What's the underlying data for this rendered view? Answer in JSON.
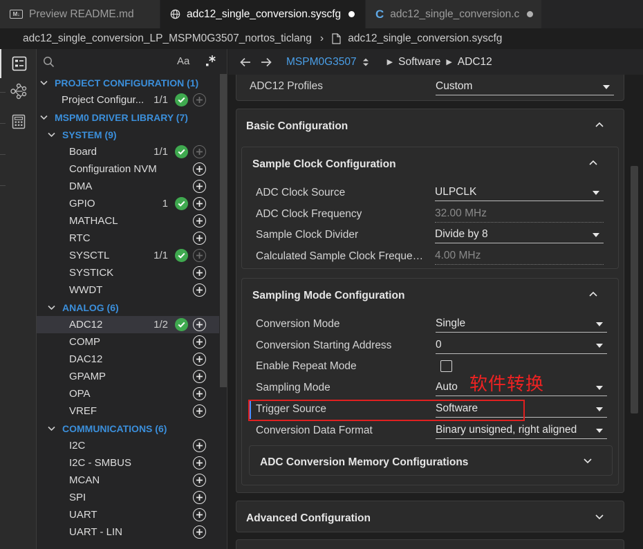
{
  "tabs": [
    {
      "label": "Preview README.md",
      "icon": "markdown-preview-icon",
      "icon_text": "M↓",
      "active": false,
      "modified": false
    },
    {
      "label": "adc12_single_conversion.syscfg",
      "icon": "globe-icon",
      "active": true,
      "modified": true
    },
    {
      "label": "adc12_single_conversion.c",
      "icon": "c-file-icon",
      "icon_text": "C",
      "active": false,
      "modified": true
    }
  ],
  "path": {
    "project": "adc12_single_conversion_LP_MSPM0G3507_nortos_ticlang",
    "file": "adc12_single_conversion.syscfg"
  },
  "sidebar": {
    "search_icon": "search-icon",
    "match_case_label": "Aa",
    "categories": [
      {
        "label": "PROJECT CONFIGURATION (1)",
        "level": 0
      },
      {
        "label": "MSPM0 DRIVER LIBRARY (7)",
        "level": 0
      },
      {
        "label": "SYSTEM (9)",
        "level": 1
      },
      {
        "label": "ANALOG (6)",
        "level": 1
      },
      {
        "label": "COMMUNICATIONS (6)",
        "level": 1
      }
    ],
    "items": [
      {
        "label": "Project Configur...",
        "count": "1/1",
        "ok": true,
        "add_enabled": false
      },
      {
        "label": "Board",
        "count": "1/1",
        "ok": true,
        "add_enabled": false
      },
      {
        "label": "Configuration NVM",
        "count": "",
        "ok": false,
        "add_enabled": true
      },
      {
        "label": "DMA",
        "count": "",
        "ok": false,
        "add_enabled": true
      },
      {
        "label": "GPIO",
        "count": "1",
        "ok": true,
        "add_enabled": true
      },
      {
        "label": "MATHACL",
        "count": "",
        "ok": false,
        "add_enabled": true
      },
      {
        "label": "RTC",
        "count": "",
        "ok": false,
        "add_enabled": true
      },
      {
        "label": "SYSCTL",
        "count": "1/1",
        "ok": true,
        "add_enabled": false
      },
      {
        "label": "SYSTICK",
        "count": "",
        "ok": false,
        "add_enabled": true
      },
      {
        "label": "WWDT",
        "count": "",
        "ok": false,
        "add_enabled": true
      },
      {
        "label": "ADC12",
        "count": "1/2",
        "ok": true,
        "add_enabled": true,
        "selected": true
      },
      {
        "label": "COMP",
        "count": "",
        "ok": false,
        "add_enabled": true
      },
      {
        "label": "DAC12",
        "count": "",
        "ok": false,
        "add_enabled": true
      },
      {
        "label": "GPAMP",
        "count": "",
        "ok": false,
        "add_enabled": true
      },
      {
        "label": "OPA",
        "count": "",
        "ok": false,
        "add_enabled": true
      },
      {
        "label": "VREF",
        "count": "",
        "ok": false,
        "add_enabled": true
      },
      {
        "label": "I2C",
        "count": "",
        "ok": false,
        "add_enabled": true
      },
      {
        "label": "I2C - SMBUS",
        "count": "",
        "ok": false,
        "add_enabled": true
      },
      {
        "label": "MCAN",
        "count": "",
        "ok": false,
        "add_enabled": true
      },
      {
        "label": "SPI",
        "count": "",
        "ok": false,
        "add_enabled": true
      },
      {
        "label": "UART",
        "count": "",
        "ok": false,
        "add_enabled": true
      },
      {
        "label": "UART - LIN",
        "count": "",
        "ok": false,
        "add_enabled": true
      }
    ]
  },
  "header": {
    "device": "MSPM0G3507",
    "crumbs": [
      "Software",
      "ADC12"
    ]
  },
  "main": {
    "adc12_profiles": {
      "label": "ADC12 Profiles",
      "value": "Custom"
    },
    "basic_config_title": "Basic Configuration",
    "sample_clock": {
      "title": "Sample Clock Configuration",
      "fields": [
        {
          "label": "ADC Clock Source",
          "value": "ULPCLK",
          "dropdown": true
        },
        {
          "label": "ADC Clock Frequency",
          "value": "32.00 MHz",
          "readonly": true
        },
        {
          "label": "Sample Clock Divider",
          "value": "Divide by 8",
          "dropdown": true
        },
        {
          "label": "Calculated Sample Clock Frequen...",
          "value": "4.00 MHz",
          "readonly": true
        }
      ]
    },
    "sampling_mode": {
      "title": "Sampling Mode Configuration",
      "fields": [
        {
          "label": "Conversion Mode",
          "value": "Single",
          "dropdown": true
        },
        {
          "label": "Conversion Starting Address",
          "value": "0",
          "dropdown": true
        },
        {
          "label": "Enable Repeat Mode",
          "checkbox": true,
          "checked": false
        },
        {
          "label": "Sampling Mode",
          "value": "Auto",
          "dropdown": true
        },
        {
          "label": "Trigger Source",
          "value": "Software",
          "dropdown": true,
          "highlighted": true
        },
        {
          "label": "Conversion Data Format",
          "value": "Binary unsigned, right aligned",
          "dropdown": true
        }
      ],
      "memory_title": "ADC Conversion Memory Configurations"
    },
    "advanced_config_title": "Advanced Configuration",
    "annotation_text": "软件转换",
    "annotation_color": "#ee2222"
  },
  "colors": {
    "accent": "#3b8fdb",
    "ok": "#3fa94f",
    "device_link": "#4a9fe8"
  }
}
